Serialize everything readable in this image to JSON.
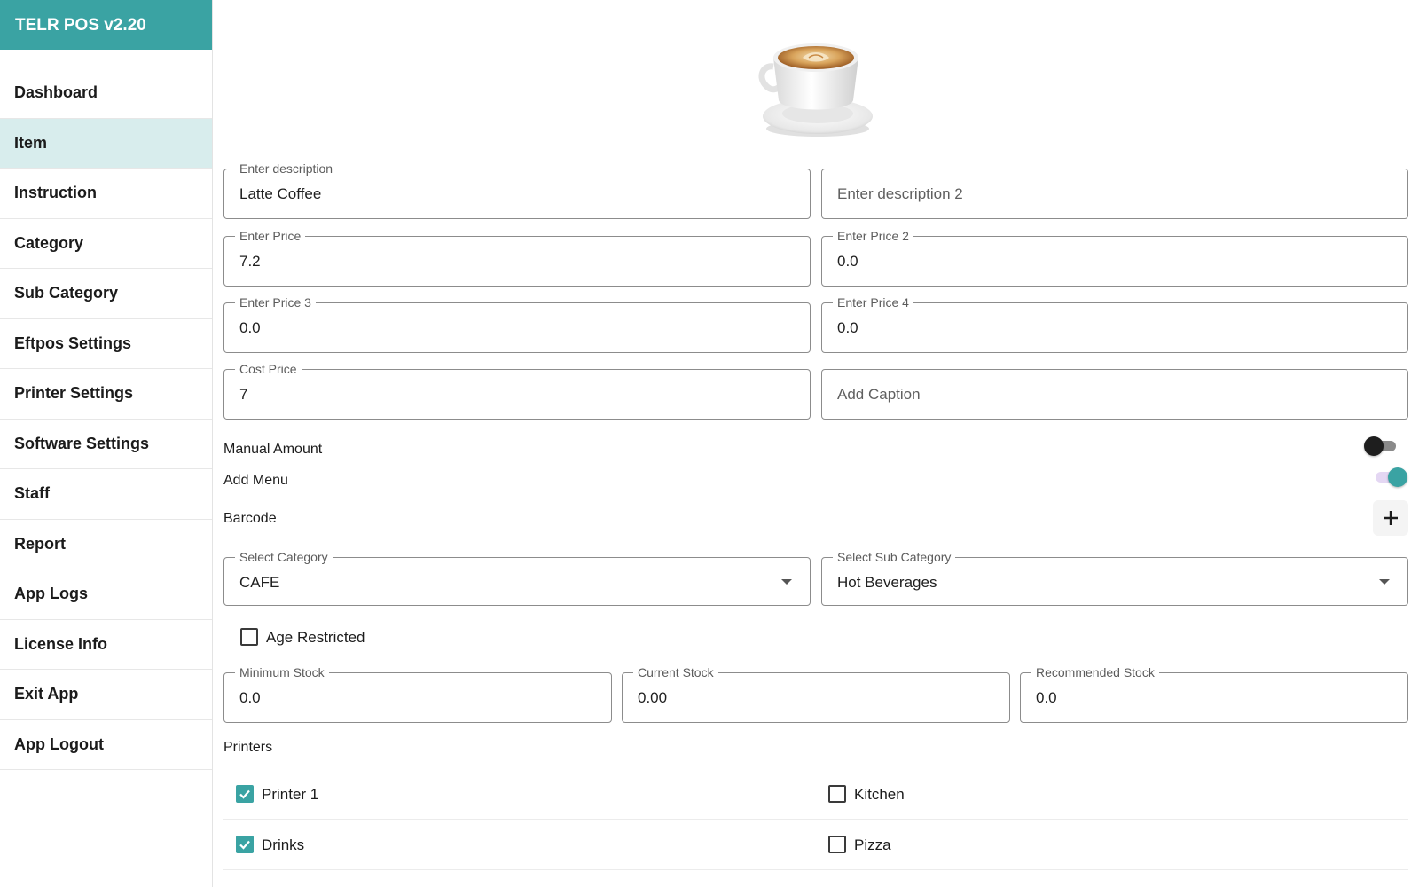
{
  "app": {
    "title": "TELR POS v2.20"
  },
  "sidebar": {
    "items": [
      {
        "label": "Dashboard",
        "active": false
      },
      {
        "label": "Item",
        "active": true
      },
      {
        "label": "Instruction",
        "active": false
      },
      {
        "label": "Category",
        "active": false
      },
      {
        "label": "Sub Category",
        "active": false
      },
      {
        "label": "Eftpos Settings",
        "active": false
      },
      {
        "label": "Printer Settings",
        "active": false
      },
      {
        "label": "Software Settings",
        "active": false
      },
      {
        "label": "Staff",
        "active": false
      },
      {
        "label": "Report",
        "active": false
      },
      {
        "label": "App Logs",
        "active": false
      },
      {
        "label": "License Info",
        "active": false
      },
      {
        "label": "Exit App",
        "active": false
      },
      {
        "label": "App Logout",
        "active": false
      }
    ]
  },
  "form": {
    "image_icon": "coffee-cup-icon",
    "description": {
      "label": "Enter description",
      "value": "Latte Coffee"
    },
    "description2": {
      "placeholder": "Enter description 2"
    },
    "price": {
      "label": "Enter Price",
      "value": "7.2"
    },
    "price2": {
      "label": "Enter Price 2",
      "value": "0.0"
    },
    "price3": {
      "label": "Enter Price 3",
      "value": "0.0"
    },
    "price4": {
      "label": "Enter Price 4",
      "value": "0.0"
    },
    "cost_price": {
      "label": "Cost Price",
      "value": "7"
    },
    "caption": {
      "placeholder": "Add Caption"
    },
    "manual_amount": {
      "label": "Manual Amount",
      "enabled": false
    },
    "add_menu": {
      "label": "Add Menu",
      "enabled": true
    },
    "barcode": {
      "label": "Barcode",
      "add_icon": "plus-icon"
    },
    "category": {
      "label": "Select Category",
      "value": "CAFE"
    },
    "sub_category": {
      "label": "Select Sub Category",
      "value": "Hot Beverages"
    },
    "age_restricted": {
      "label": "Age Restricted",
      "checked": false
    },
    "min_stock": {
      "label": "Minimum Stock",
      "value": "0.0"
    },
    "current_stock": {
      "label": "Current Stock",
      "value": "0.00"
    },
    "recommended_stock": {
      "label": "Recommended Stock",
      "value": "0.0"
    },
    "printers": {
      "title": "Printers",
      "items": [
        {
          "label": "Printer 1",
          "checked": true
        },
        {
          "label": "Kitchen",
          "checked": false
        },
        {
          "label": "Drinks",
          "checked": true
        },
        {
          "label": "Pizza",
          "checked": false
        }
      ]
    }
  },
  "colors": {
    "accent": "#3aa3a3",
    "active_nav_bg": "#d8eded",
    "toggle_on_track": "#e4d7f3"
  }
}
